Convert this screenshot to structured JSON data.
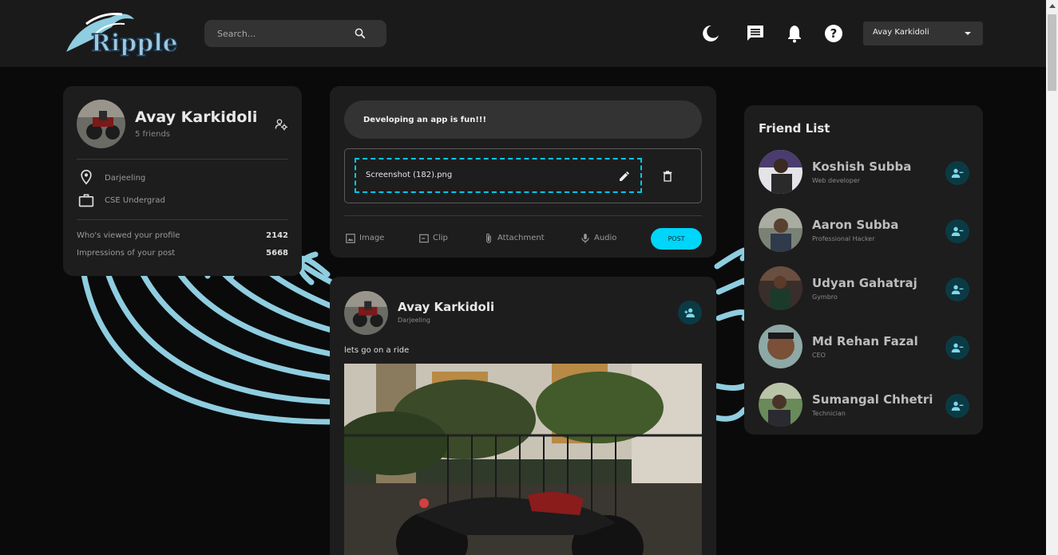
{
  "navbar": {
    "logo_text": "Ripple",
    "search_placeholder": "Search...",
    "user_select": "Avay Karkidoli",
    "icons": [
      "dark-mode-icon",
      "message-icon",
      "notifications-icon",
      "help-icon"
    ]
  },
  "profile": {
    "name": "Avay Karkidoli",
    "friends": "5 friends",
    "location": "Darjeeling",
    "occupation": "CSE Undergrad",
    "stats": [
      {
        "label": "Who's viewed your profile",
        "value": "2142"
      },
      {
        "label": "Impressions of your post",
        "value": "5668"
      }
    ]
  },
  "composer": {
    "text": "Developing an app is fun!!!",
    "file_name": "Screenshot (182).png",
    "actions": [
      "Image",
      "Clip",
      "Attachment",
      "Audio"
    ],
    "post_button": "POST"
  },
  "post": {
    "name": "Avay Karkidoli",
    "location": "Darjeeling",
    "text": "lets go on a ride"
  },
  "friend_list": {
    "title": "Friend List",
    "friends": [
      {
        "name": "Koshish Subba",
        "role": "Web developer"
      },
      {
        "name": "Aaron Subba",
        "role": "Professional Hacker"
      },
      {
        "name": "Udyan Gahatraj",
        "role": "Gymbro"
      },
      {
        "name": "Md Rehan Fazal",
        "role": "CEO"
      },
      {
        "name": "Sumangal Chhetri",
        "role": "Technician"
      }
    ]
  },
  "colors": {
    "accent": "#00d5fa",
    "card": "#1d1d1d",
    "navbar": "#1a1a1a",
    "background": "#0a0a0a",
    "wave": "#8fcde0"
  }
}
